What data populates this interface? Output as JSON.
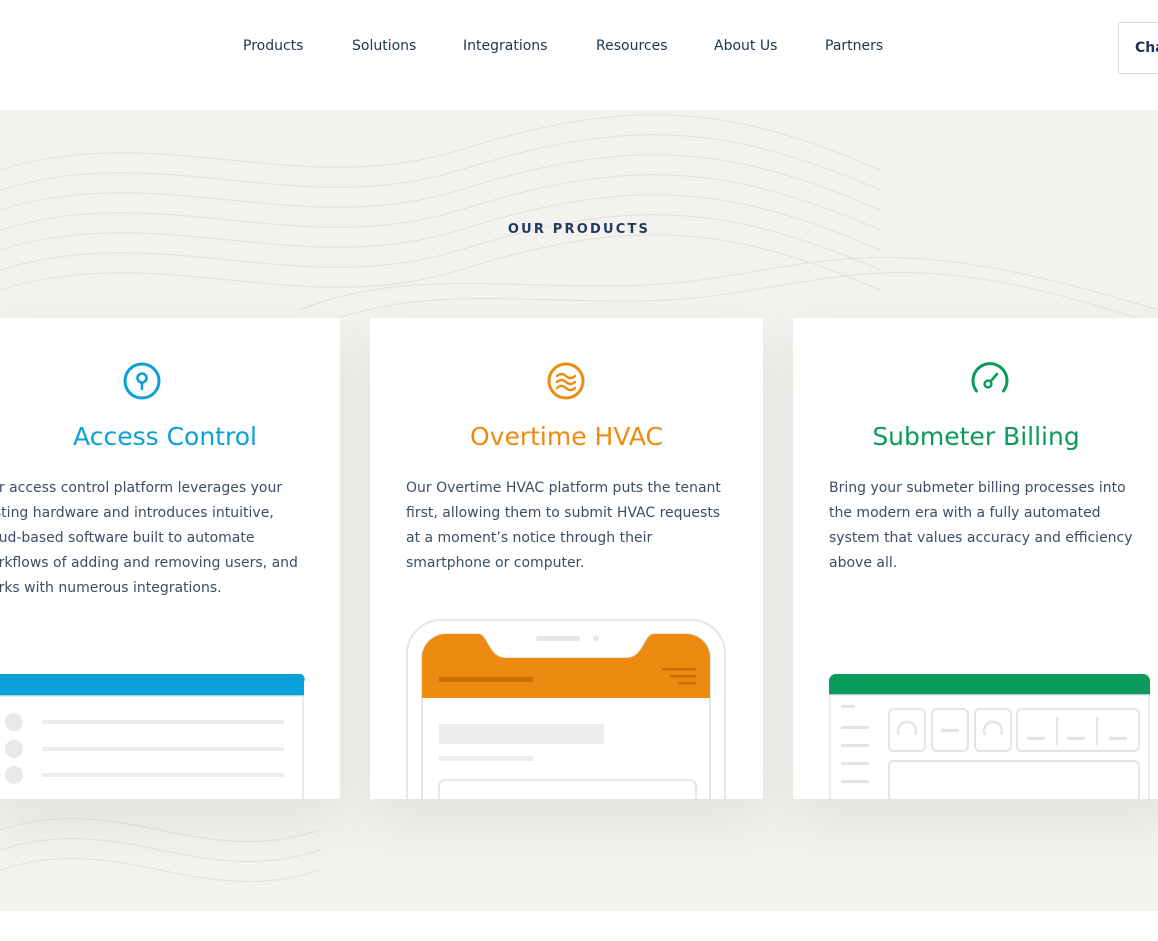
{
  "nav": {
    "items": [
      "Products",
      "Solutions",
      "Integrations",
      "Resources",
      "About Us",
      "Partners"
    ],
    "cta_label": "Chat"
  },
  "section": {
    "label": "OUR PRODUCTS"
  },
  "cards": [
    {
      "title": "Access Control",
      "text": "ur access control platform leverages your\nisting hardware and introduces intuitive,\noud-based software built to automate\norkflows of adding and removing users, and\norks with numerous integrations.",
      "icon": "keyhole-icon",
      "color": "#0aa0d9"
    },
    {
      "title": "Overtime HVAC",
      "text": "Our Overtime HVAC platform puts the tenant\nfirst, allowing them to submit HVAC requests\nat a moment’s notice through their\nsmartphone or computer.",
      "icon": "airflow-icon",
      "color": "#ed8b10"
    },
    {
      "title": "Submeter Billing",
      "text": "Bring your submeter billing processes into\nthe modern era with a fully automated\nsystem that values accuracy and efficiency\nabove all.",
      "icon": "gauge-icon",
      "color": "#0a9a5b"
    }
  ],
  "colors": {
    "navy": "#1f3450",
    "band_background": "#f3f2ef",
    "access_blue": "#0aa0d9",
    "hvac_orange": "#ed8b10",
    "billing_green": "#0a9a5b"
  }
}
